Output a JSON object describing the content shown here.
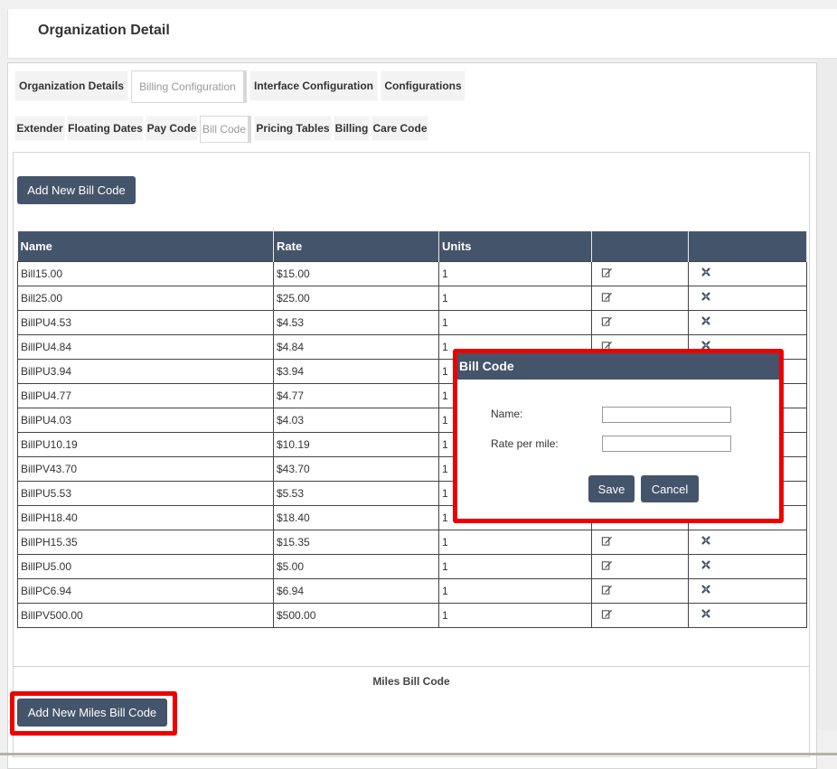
{
  "page": {
    "title": "Organization Detail"
  },
  "main_tabs": [
    {
      "label": "Organization Details",
      "active": false
    },
    {
      "label": "Billing Configuration",
      "active": true
    },
    {
      "label": "Interface Configuration",
      "active": false
    },
    {
      "label": "Configurations",
      "active": false
    }
  ],
  "sub_tabs": [
    {
      "label": "Extender",
      "active": false
    },
    {
      "label": "Floating Dates",
      "active": false
    },
    {
      "label": "Pay Code",
      "active": false
    },
    {
      "label": "Bill Code",
      "active": true
    },
    {
      "label": "Pricing Tables",
      "active": false
    },
    {
      "label": "Billing",
      "active": false
    },
    {
      "label": "Care Code",
      "active": false
    }
  ],
  "bill_code": {
    "add_button": "Add New Bill Code",
    "columns": [
      "Name",
      "Rate",
      "Units",
      "",
      ""
    ],
    "rows": [
      {
        "name": "Bill15.00",
        "rate": "$15.00",
        "units": "1"
      },
      {
        "name": "Bill25.00",
        "rate": "$25.00",
        "units": "1"
      },
      {
        "name": "BillPU4.53",
        "rate": "$4.53",
        "units": "1"
      },
      {
        "name": "BillPU4.84",
        "rate": "$4.84",
        "units": "1"
      },
      {
        "name": "BillPU3.94",
        "rate": "$3.94",
        "units": "1"
      },
      {
        "name": "BillPU4.77",
        "rate": "$4.77",
        "units": "1"
      },
      {
        "name": "BillPU4.03",
        "rate": "$4.03",
        "units": "1"
      },
      {
        "name": "BillPU10.19",
        "rate": "$10.19",
        "units": "1"
      },
      {
        "name": "BillPV43.70",
        "rate": "$43.70",
        "units": "1"
      },
      {
        "name": "BillPU5.53",
        "rate": "$5.53",
        "units": "1"
      },
      {
        "name": "BillPH18.40",
        "rate": "$18.40",
        "units": "1"
      },
      {
        "name": "BillPH15.35",
        "rate": "$15.35",
        "units": "1"
      },
      {
        "name": "BillPU5.00",
        "rate": "$5.00",
        "units": "1"
      },
      {
        "name": "BillPC6.94",
        "rate": "$6.94",
        "units": "1"
      },
      {
        "name": "BillPV500.00",
        "rate": "$500.00",
        "units": "1"
      }
    ],
    "edit_icon": "edit-icon",
    "delete_icon": "delete-icon"
  },
  "miles": {
    "section_label": "Miles Bill Code",
    "add_button": "Add New Miles Bill Code"
  },
  "modal": {
    "title": "Bill Code",
    "name_label": "Name:",
    "name_value": "",
    "rate_label": "Rate per mile:",
    "rate_value": "",
    "save_label": "Save",
    "cancel_label": "Cancel"
  },
  "colors": {
    "header_bg": "#44546a",
    "highlight": "#ee0000"
  }
}
